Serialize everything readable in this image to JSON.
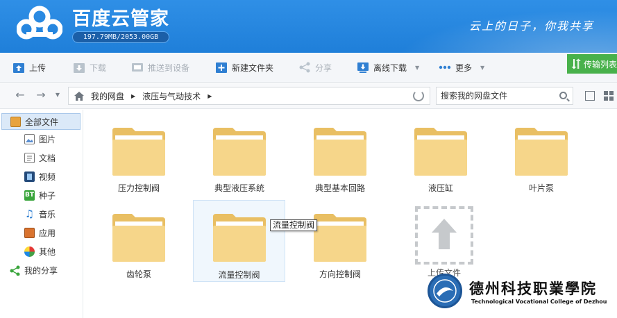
{
  "header": {
    "title": "百度云管家",
    "quota": "197.79MB/2053.00GB",
    "slogan": "云上的日子，你我共享"
  },
  "toolbar": {
    "upload": "上传",
    "download": "下载",
    "push_device": "推送到设备",
    "new_folder": "新建文件夹",
    "share": "分享",
    "offline_download": "离线下载",
    "more": "更多",
    "transfer_list": "传输列表"
  },
  "nav": {
    "breadcrumb": [
      "我的网盘",
      "液压与气动技术"
    ],
    "search_placeholder": "搜索我的网盘文件"
  },
  "sidebar": {
    "items": [
      {
        "label": "全部文件",
        "icon": "all-files-icon"
      },
      {
        "label": "图片",
        "icon": "image-icon"
      },
      {
        "label": "文档",
        "icon": "document-icon"
      },
      {
        "label": "视频",
        "icon": "video-icon"
      },
      {
        "label": "种子",
        "icon": "bt-icon"
      },
      {
        "label": "音乐",
        "icon": "music-icon"
      },
      {
        "label": "应用",
        "icon": "app-icon"
      },
      {
        "label": "其他",
        "icon": "other-icon"
      },
      {
        "label": "我的分享",
        "icon": "share-icon"
      }
    ]
  },
  "folders": [
    "压力控制阀",
    "典型液压系统",
    "典型基本回路",
    "液压缸",
    "叶片泵",
    "齿轮泵",
    "流量控制阀",
    "方向控制阀"
  ],
  "tooltip": "流量控制阀",
  "upload_label": "上传文件",
  "watermark": {
    "name": "德州科技职業學院",
    "english": "Technological Vocational College of Dezhou"
  },
  "colors": {
    "header_blue": "#2a88e2",
    "folder_fill": "#f6d68a",
    "transfer_green": "#48b14b"
  }
}
